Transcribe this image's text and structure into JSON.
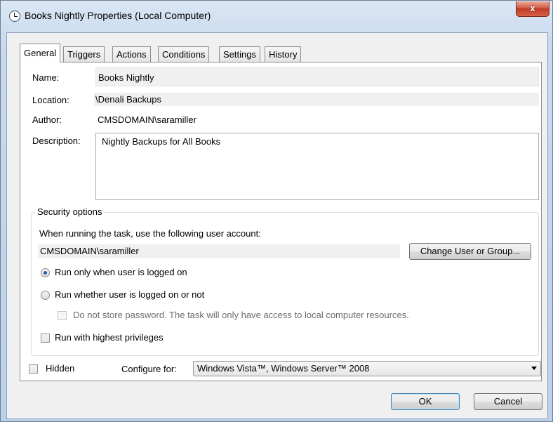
{
  "window": {
    "title": "Books Nightly Properties (Local Computer)",
    "close_label": "x"
  },
  "tabs": [
    {
      "label": "General",
      "active": true
    },
    {
      "label": "Triggers"
    },
    {
      "label": "Actions"
    },
    {
      "label": "Conditions"
    },
    {
      "label": "Settings"
    },
    {
      "label": "History"
    }
  ],
  "general": {
    "name_label": "Name:",
    "name_value": "Books Nightly",
    "location_label": "Location:",
    "location_value": "\\Denali Backups",
    "author_label": "Author:",
    "author_value": "CMSDOMAIN\\saramiller",
    "description_label": "Description:",
    "description_value": "Nightly Backups for All Books"
  },
  "security": {
    "legend": "Security options",
    "account_prompt": "When running the task, use the following user account:",
    "account_value": "CMSDOMAIN\\saramiller",
    "change_button": "Change User or Group...",
    "radio_logged_on": "Run only when user is logged on",
    "radio_logged_on_checked": true,
    "radio_whether": "Run whether user is logged on or not",
    "radio_whether_checked": false,
    "no_store_password": "Do not store password.  The task will only have access to local computer resources.",
    "highest_privileges": "Run with highest privileges"
  },
  "bottom": {
    "hidden_label": "Hidden",
    "configure_label": "Configure for:",
    "configure_value": "Windows Vista™, Windows Server™ 2008"
  },
  "buttons": {
    "ok": "OK",
    "cancel": "Cancel"
  }
}
